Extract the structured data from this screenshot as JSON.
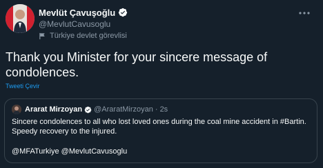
{
  "tweet": {
    "author": {
      "display_name": "Mevlüt Çavuşoğlu",
      "handle": "@MevlutCavusoglu",
      "affiliation": "Türkiye devlet görevlisi"
    },
    "text": "Thank you Minister for your sincere message of condolences.",
    "translate_label": "Tweeti Çevir"
  },
  "quoted_tweet": {
    "author": {
      "display_name": "Ararat Mirzoyan",
      "handle": "@AraratMirzoyan",
      "separator": "·",
      "time": "2s"
    },
    "text": "Sincere condolences to all who lost loved ones during the coal mine accident in #Bartin. Speedy recovery to the injured.",
    "mentions": "@MFATurkiye @MevlutCavusoglu"
  },
  "colors": {
    "background": "#15202b",
    "text_primary": "#f7f9f9",
    "text_secondary": "#8b98a5",
    "accent": "#1d9bf0",
    "border": "#38444d"
  },
  "icons": {
    "verified": "verified-badge-icon",
    "affiliation": "flag-icon",
    "more": "more-options-icon"
  }
}
